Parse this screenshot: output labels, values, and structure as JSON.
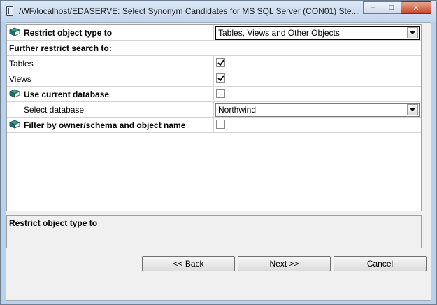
{
  "window": {
    "title": "/WF/localhost/EDASERVE: Select Synonym Candidates for MS SQL Server (CON01)     Ste...",
    "minimize": "–",
    "maximize": "□",
    "close": "✕"
  },
  "options": {
    "restrict_type": {
      "label": "Restrict object type to",
      "value": "Tables, Views and Other Objects"
    },
    "further_label": "Further restrict search to:",
    "tables": {
      "label": "Tables",
      "checked": true
    },
    "views": {
      "label": "Views",
      "checked": true
    },
    "use_current_db": {
      "label": "Use current database",
      "checked": false
    },
    "select_db": {
      "label": "Select database",
      "value": "Northwind"
    },
    "filter_owner": {
      "label": "Filter by owner/schema and object name",
      "checked": false
    }
  },
  "description": {
    "title": "Restrict object type to"
  },
  "buttons": {
    "back": "<< Back",
    "next": "Next >>",
    "cancel": "Cancel"
  },
  "colors": {
    "title_bar": "#c3d6ec",
    "close_button": "#c7462b",
    "grid_bg": "#ffffff"
  }
}
